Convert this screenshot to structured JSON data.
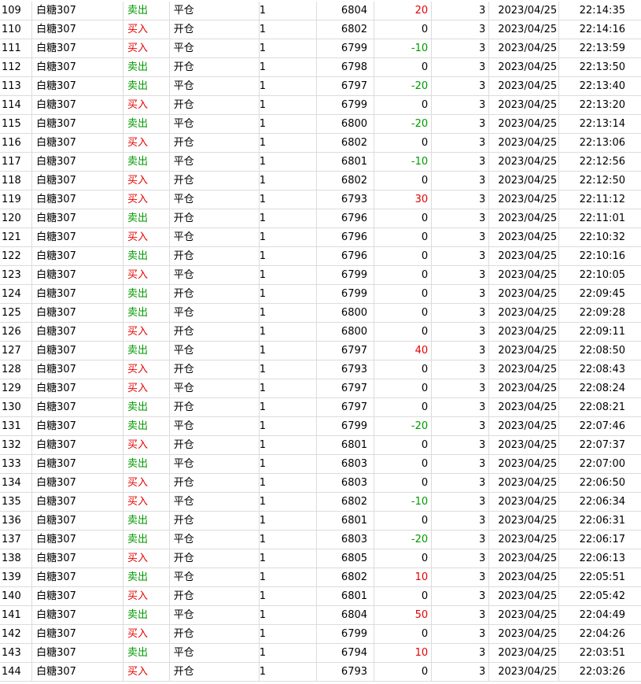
{
  "colors": {
    "buy": "#e60000",
    "sell": "#009900",
    "grid": "#dcdcdc"
  },
  "rows": [
    {
      "idx": "109",
      "name": "白糖307",
      "dir": "卖出",
      "side": "sell",
      "type": "平仓",
      "vol": "1",
      "price": "6804",
      "pnl": "20",
      "fee": "3",
      "date": "2023/04/25",
      "time": "22:14:35"
    },
    {
      "idx": "110",
      "name": "白糖307",
      "dir": "买入",
      "side": "buy",
      "type": "开仓",
      "vol": "1",
      "price": "6802",
      "pnl": "0",
      "fee": "3",
      "date": "2023/04/25",
      "time": "22:14:16"
    },
    {
      "idx": "111",
      "name": "白糖307",
      "dir": "买入",
      "side": "buy",
      "type": "平仓",
      "vol": "1",
      "price": "6799",
      "pnl": "-10",
      "fee": "3",
      "date": "2023/04/25",
      "time": "22:13:59"
    },
    {
      "idx": "112",
      "name": "白糖307",
      "dir": "卖出",
      "side": "sell",
      "type": "开仓",
      "vol": "1",
      "price": "6798",
      "pnl": "0",
      "fee": "3",
      "date": "2023/04/25",
      "time": "22:13:50"
    },
    {
      "idx": "113",
      "name": "白糖307",
      "dir": "卖出",
      "side": "sell",
      "type": "平仓",
      "vol": "1",
      "price": "6797",
      "pnl": "-20",
      "fee": "3",
      "date": "2023/04/25",
      "time": "22:13:40"
    },
    {
      "idx": "114",
      "name": "白糖307",
      "dir": "买入",
      "side": "buy",
      "type": "开仓",
      "vol": "1",
      "price": "6799",
      "pnl": "0",
      "fee": "3",
      "date": "2023/04/25",
      "time": "22:13:20"
    },
    {
      "idx": "115",
      "name": "白糖307",
      "dir": "卖出",
      "side": "sell",
      "type": "平仓",
      "vol": "1",
      "price": "6800",
      "pnl": "-20",
      "fee": "3",
      "date": "2023/04/25",
      "time": "22:13:14"
    },
    {
      "idx": "116",
      "name": "白糖307",
      "dir": "买入",
      "side": "buy",
      "type": "开仓",
      "vol": "1",
      "price": "6802",
      "pnl": "0",
      "fee": "3",
      "date": "2023/04/25",
      "time": "22:13:06"
    },
    {
      "idx": "117",
      "name": "白糖307",
      "dir": "卖出",
      "side": "sell",
      "type": "平仓",
      "vol": "1",
      "price": "6801",
      "pnl": "-10",
      "fee": "3",
      "date": "2023/04/25",
      "time": "22:12:56"
    },
    {
      "idx": "118",
      "name": "白糖307",
      "dir": "买入",
      "side": "buy",
      "type": "开仓",
      "vol": "1",
      "price": "6802",
      "pnl": "0",
      "fee": "3",
      "date": "2023/04/25",
      "time": "22:12:50"
    },
    {
      "idx": "119",
      "name": "白糖307",
      "dir": "买入",
      "side": "buy",
      "type": "平仓",
      "vol": "1",
      "price": "6793",
      "pnl": "30",
      "fee": "3",
      "date": "2023/04/25",
      "time": "22:11:12"
    },
    {
      "idx": "120",
      "name": "白糖307",
      "dir": "卖出",
      "side": "sell",
      "type": "开仓",
      "vol": "1",
      "price": "6796",
      "pnl": "0",
      "fee": "3",
      "date": "2023/04/25",
      "time": "22:11:01"
    },
    {
      "idx": "121",
      "name": "白糖307",
      "dir": "买入",
      "side": "buy",
      "type": "平仓",
      "vol": "1",
      "price": "6796",
      "pnl": "0",
      "fee": "3",
      "date": "2023/04/25",
      "time": "22:10:32"
    },
    {
      "idx": "122",
      "name": "白糖307",
      "dir": "卖出",
      "side": "sell",
      "type": "开仓",
      "vol": "1",
      "price": "6796",
      "pnl": "0",
      "fee": "3",
      "date": "2023/04/25",
      "time": "22:10:16"
    },
    {
      "idx": "123",
      "name": "白糖307",
      "dir": "买入",
      "side": "buy",
      "type": "平仓",
      "vol": "1",
      "price": "6799",
      "pnl": "0",
      "fee": "3",
      "date": "2023/04/25",
      "time": "22:10:05"
    },
    {
      "idx": "124",
      "name": "白糖307",
      "dir": "卖出",
      "side": "sell",
      "type": "开仓",
      "vol": "1",
      "price": "6799",
      "pnl": "0",
      "fee": "3",
      "date": "2023/04/25",
      "time": "22:09:45"
    },
    {
      "idx": "125",
      "name": "白糖307",
      "dir": "卖出",
      "side": "sell",
      "type": "平仓",
      "vol": "1",
      "price": "6800",
      "pnl": "0",
      "fee": "3",
      "date": "2023/04/25",
      "time": "22:09:28"
    },
    {
      "idx": "126",
      "name": "白糖307",
      "dir": "买入",
      "side": "buy",
      "type": "开仓",
      "vol": "1",
      "price": "6800",
      "pnl": "0",
      "fee": "3",
      "date": "2023/04/25",
      "time": "22:09:11"
    },
    {
      "idx": "127",
      "name": "白糖307",
      "dir": "卖出",
      "side": "sell",
      "type": "平仓",
      "vol": "1",
      "price": "6797",
      "pnl": "40",
      "fee": "3",
      "date": "2023/04/25",
      "time": "22:08:50"
    },
    {
      "idx": "128",
      "name": "白糖307",
      "dir": "买入",
      "side": "buy",
      "type": "开仓",
      "vol": "1",
      "price": "6793",
      "pnl": "0",
      "fee": "3",
      "date": "2023/04/25",
      "time": "22:08:43"
    },
    {
      "idx": "129",
      "name": "白糖307",
      "dir": "买入",
      "side": "buy",
      "type": "平仓",
      "vol": "1",
      "price": "6797",
      "pnl": "0",
      "fee": "3",
      "date": "2023/04/25",
      "time": "22:08:24"
    },
    {
      "idx": "130",
      "name": "白糖307",
      "dir": "卖出",
      "side": "sell",
      "type": "开仓",
      "vol": "1",
      "price": "6797",
      "pnl": "0",
      "fee": "3",
      "date": "2023/04/25",
      "time": "22:08:21"
    },
    {
      "idx": "131",
      "name": "白糖307",
      "dir": "卖出",
      "side": "sell",
      "type": "平仓",
      "vol": "1",
      "price": "6799",
      "pnl": "-20",
      "fee": "3",
      "date": "2023/04/25",
      "time": "22:07:46"
    },
    {
      "idx": "132",
      "name": "白糖307",
      "dir": "买入",
      "side": "buy",
      "type": "开仓",
      "vol": "1",
      "price": "6801",
      "pnl": "0",
      "fee": "3",
      "date": "2023/04/25",
      "time": "22:07:37"
    },
    {
      "idx": "133",
      "name": "白糖307",
      "dir": "卖出",
      "side": "sell",
      "type": "平仓",
      "vol": "1",
      "price": "6803",
      "pnl": "0",
      "fee": "3",
      "date": "2023/04/25",
      "time": "22:07:00"
    },
    {
      "idx": "134",
      "name": "白糖307",
      "dir": "买入",
      "side": "buy",
      "type": "开仓",
      "vol": "1",
      "price": "6803",
      "pnl": "0",
      "fee": "3",
      "date": "2023/04/25",
      "time": "22:06:50"
    },
    {
      "idx": "135",
      "name": "白糖307",
      "dir": "买入",
      "side": "buy",
      "type": "平仓",
      "vol": "1",
      "price": "6802",
      "pnl": "-10",
      "fee": "3",
      "date": "2023/04/25",
      "time": "22:06:34"
    },
    {
      "idx": "136",
      "name": "白糖307",
      "dir": "卖出",
      "side": "sell",
      "type": "开仓",
      "vol": "1",
      "price": "6801",
      "pnl": "0",
      "fee": "3",
      "date": "2023/04/25",
      "time": "22:06:31"
    },
    {
      "idx": "137",
      "name": "白糖307",
      "dir": "卖出",
      "side": "sell",
      "type": "平仓",
      "vol": "1",
      "price": "6803",
      "pnl": "-20",
      "fee": "3",
      "date": "2023/04/25",
      "time": "22:06:17"
    },
    {
      "idx": "138",
      "name": "白糖307",
      "dir": "买入",
      "side": "buy",
      "type": "开仓",
      "vol": "1",
      "price": "6805",
      "pnl": "0",
      "fee": "3",
      "date": "2023/04/25",
      "time": "22:06:13"
    },
    {
      "idx": "139",
      "name": "白糖307",
      "dir": "卖出",
      "side": "sell",
      "type": "平仓",
      "vol": "1",
      "price": "6802",
      "pnl": "10",
      "fee": "3",
      "date": "2023/04/25",
      "time": "22:05:51"
    },
    {
      "idx": "140",
      "name": "白糖307",
      "dir": "买入",
      "side": "buy",
      "type": "开仓",
      "vol": "1",
      "price": "6801",
      "pnl": "0",
      "fee": "3",
      "date": "2023/04/25",
      "time": "22:05:42"
    },
    {
      "idx": "141",
      "name": "白糖307",
      "dir": "卖出",
      "side": "sell",
      "type": "平仓",
      "vol": "1",
      "price": "6804",
      "pnl": "50",
      "fee": "3",
      "date": "2023/04/25",
      "time": "22:04:49"
    },
    {
      "idx": "142",
      "name": "白糖307",
      "dir": "买入",
      "side": "buy",
      "type": "开仓",
      "vol": "1",
      "price": "6799",
      "pnl": "0",
      "fee": "3",
      "date": "2023/04/25",
      "time": "22:04:26"
    },
    {
      "idx": "143",
      "name": "白糖307",
      "dir": "卖出",
      "side": "sell",
      "type": "平仓",
      "vol": "1",
      "price": "6794",
      "pnl": "10",
      "fee": "3",
      "date": "2023/04/25",
      "time": "22:03:51"
    },
    {
      "idx": "144",
      "name": "白糖307",
      "dir": "买入",
      "side": "buy",
      "type": "开仓",
      "vol": "1",
      "price": "6793",
      "pnl": "0",
      "fee": "3",
      "date": "2023/04/25",
      "time": "22:03:26"
    }
  ]
}
